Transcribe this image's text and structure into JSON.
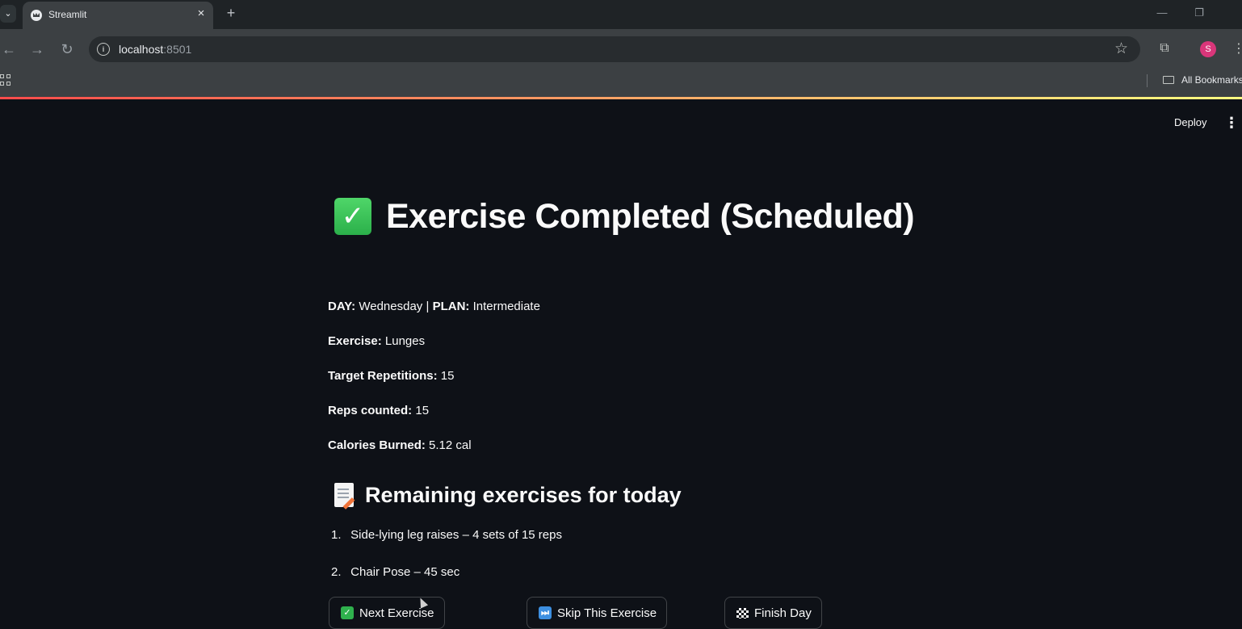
{
  "browser": {
    "tab_title": "Streamlit",
    "tab_close": "×",
    "new_tab": "+",
    "url_host": "localhost",
    "url_port": ":8501",
    "profile_initial": "S",
    "bookmarks_label": "All Bookmarks",
    "icons": [
      "tab-search-icon",
      "streamlit-favicon",
      "close-icon",
      "new-tab-icon",
      "minimize-icon",
      "maximize-icon",
      "back-icon",
      "forward-icon",
      "reload-icon",
      "site-info-icon",
      "star-icon",
      "extensions-icon",
      "profile-avatar",
      "menu-kebab-icon",
      "apps-grid-icon",
      "folder-icon"
    ]
  },
  "app": {
    "deploy_label": "Deploy",
    "title": "Exercise Completed (Scheduled)",
    "info": {
      "day_label": "DAY:",
      "day_value": "Wednesday",
      "separator": "|",
      "plan_label": "PLAN:",
      "plan_value": "Intermediate",
      "exercise_label": "Exercise:",
      "exercise_value": "Lunges",
      "target_label": "Target Repetitions:",
      "target_value": "15",
      "reps_label": "Reps counted:",
      "reps_value": "15",
      "calories_label": "Calories Burned:",
      "calories_value": "5.12 cal"
    },
    "remaining_heading": "Remaining exercises for today",
    "remaining": [
      {
        "num": "1.",
        "text": "Side-lying leg raises – 4 sets of 15 reps"
      },
      {
        "num": "2.",
        "text": "Chair Pose – 45 sec"
      }
    ],
    "buttons": {
      "next": "Next Exercise",
      "skip": "Skip This Exercise",
      "finish": "Finish Day"
    },
    "colors": {
      "background": "#0e1117",
      "text": "#fafafa",
      "check_green": "#2fb14d",
      "skip_blue": "#3d8fe0"
    }
  }
}
